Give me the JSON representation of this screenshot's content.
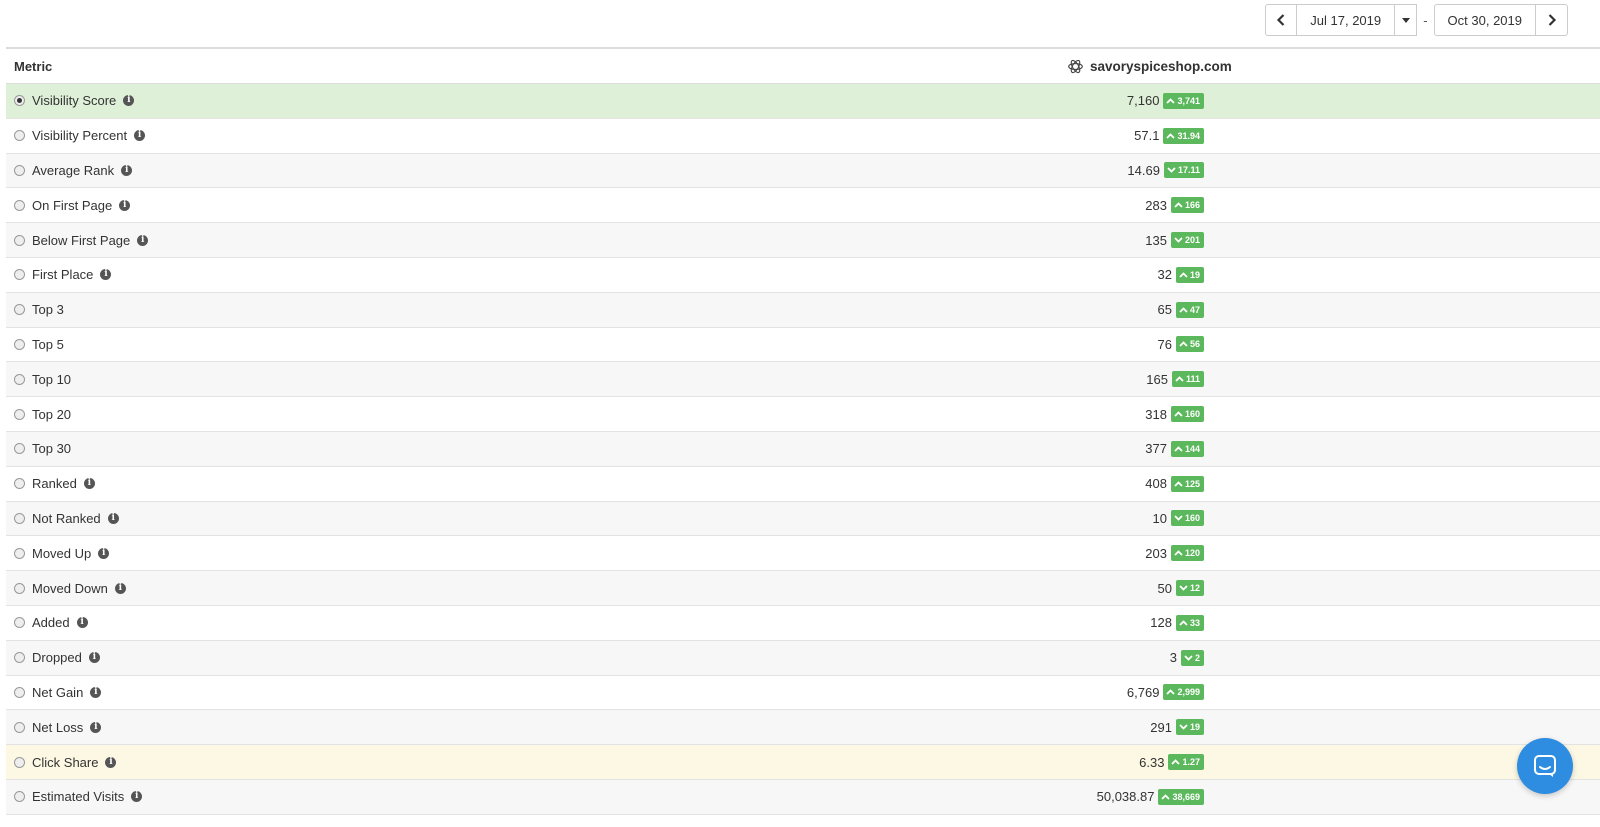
{
  "date_range": {
    "start": "Jul 17, 2019",
    "separator": "-",
    "end": "Oct 30, 2019"
  },
  "table": {
    "metric_header": "Metric",
    "site_header": "savoryspiceshop.com",
    "rows": [
      {
        "label": "Visibility Score",
        "info": true,
        "value": "7,160",
        "change": "3,741",
        "direction": "up",
        "state": "selected"
      },
      {
        "label": "Visibility Percent",
        "info": true,
        "value": "57.1",
        "change": "31.94",
        "direction": "up",
        "state": "even"
      },
      {
        "label": "Average Rank",
        "info": true,
        "value": "14.69",
        "change": "17.11",
        "direction": "down",
        "state": "odd"
      },
      {
        "label": "On First Page",
        "info": true,
        "value": "283",
        "change": "166",
        "direction": "up",
        "state": "even"
      },
      {
        "label": "Below First Page",
        "info": true,
        "value": "135",
        "change": "201",
        "direction": "down",
        "state": "odd"
      },
      {
        "label": "First Place",
        "info": true,
        "value": "32",
        "change": "19",
        "direction": "up",
        "state": "even"
      },
      {
        "label": "Top 3",
        "info": false,
        "value": "65",
        "change": "47",
        "direction": "up",
        "state": "odd"
      },
      {
        "label": "Top 5",
        "info": false,
        "value": "76",
        "change": "56",
        "direction": "up",
        "state": "even"
      },
      {
        "label": "Top 10",
        "info": false,
        "value": "165",
        "change": "111",
        "direction": "up",
        "state": "odd"
      },
      {
        "label": "Top 20",
        "info": false,
        "value": "318",
        "change": "160",
        "direction": "up",
        "state": "even"
      },
      {
        "label": "Top 30",
        "info": false,
        "value": "377",
        "change": "144",
        "direction": "up",
        "state": "odd"
      },
      {
        "label": "Ranked",
        "info": true,
        "value": "408",
        "change": "125",
        "direction": "up",
        "state": "even"
      },
      {
        "label": "Not Ranked",
        "info": true,
        "value": "10",
        "change": "160",
        "direction": "down",
        "state": "odd"
      },
      {
        "label": "Moved Up",
        "info": true,
        "value": "203",
        "change": "120",
        "direction": "up",
        "state": "even"
      },
      {
        "label": "Moved Down",
        "info": true,
        "value": "50",
        "change": "12",
        "direction": "down",
        "state": "odd"
      },
      {
        "label": "Added",
        "info": true,
        "value": "128",
        "change": "33",
        "direction": "up",
        "state": "even"
      },
      {
        "label": "Dropped",
        "info": true,
        "value": "3",
        "change": "2",
        "direction": "down",
        "state": "odd"
      },
      {
        "label": "Net Gain",
        "info": true,
        "value": "6,769",
        "change": "2,999",
        "direction": "up",
        "state": "even"
      },
      {
        "label": "Net Loss",
        "info": true,
        "value": "291",
        "change": "19",
        "direction": "down",
        "state": "odd"
      },
      {
        "label": "Click Share",
        "info": true,
        "value": "6.33",
        "change": "1.27",
        "direction": "up",
        "state": "highlight"
      },
      {
        "label": "Estimated Visits",
        "info": true,
        "value": "50,038.87",
        "change": "38,669",
        "direction": "up",
        "state": "odd"
      }
    ]
  },
  "colors": {
    "selected_row": "#dff0d8",
    "highlight_row": "#fcf8e3",
    "badge_green": "#5cb85c",
    "chat_blue": "#2e8de0"
  },
  "icons": {
    "prev": "chevron-left-icon",
    "next": "chevron-right-icon",
    "caret": "caret-down-icon",
    "site": "site-logo-icon",
    "info": "info-icon",
    "chat": "chat-icon"
  }
}
